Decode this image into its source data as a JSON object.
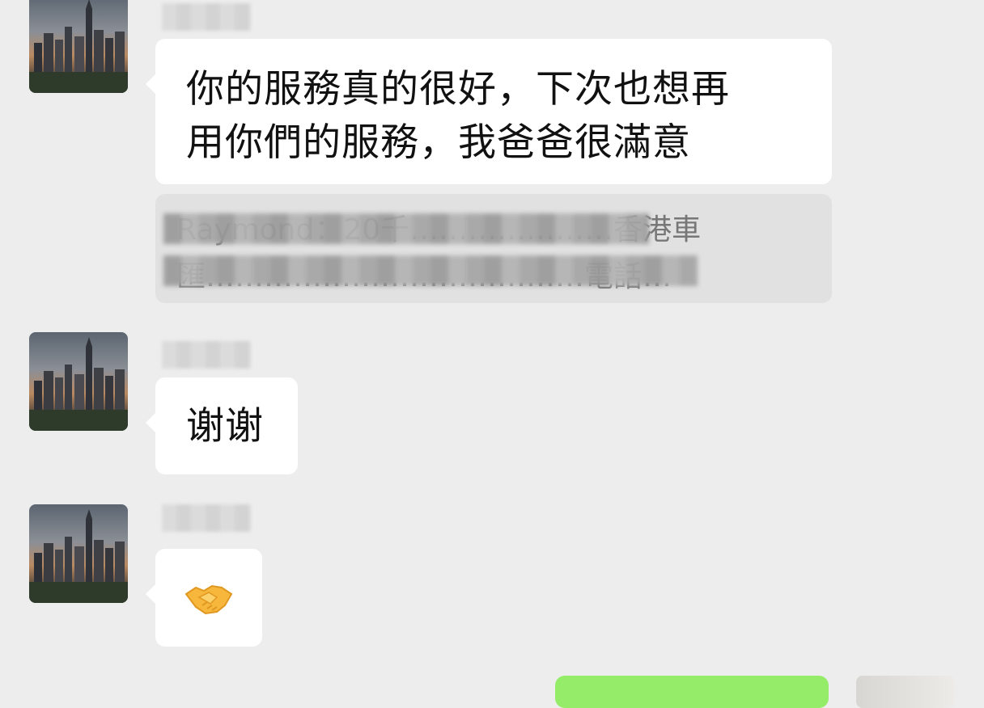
{
  "chat": {
    "messages": [
      {
        "sender": "other",
        "text": "你的服務真的很好，下次也想再\n用你們的服務，我爸爸很滿意"
      },
      {
        "sender": "other",
        "quote": "Raymond：20千…………………香港車\n匯…………………………………電話…"
      },
      {
        "sender": "other",
        "text": "谢谢"
      },
      {
        "sender": "other",
        "emoji": "handshake"
      }
    ]
  },
  "icons": {
    "avatar": "city-skyline-avatar",
    "emoji": "handshake-emoji"
  },
  "colors": {
    "background": "#ededed",
    "incoming_bubble": "#ffffff",
    "outgoing_bubble": "#95ec69",
    "quote_bg": "#e1e1e1"
  }
}
